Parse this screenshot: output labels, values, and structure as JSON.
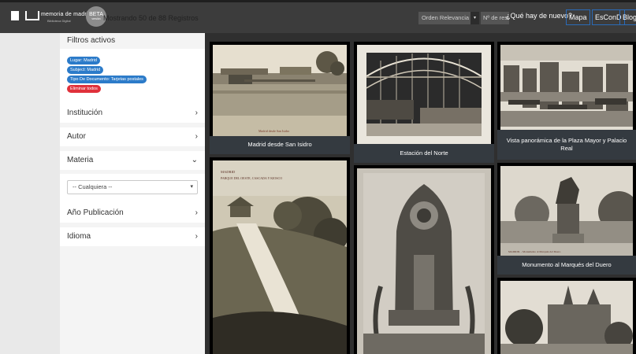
{
  "header": {
    "logo_title": "memoria de madrid",
    "logo_subtitle": "Biblioteca Digital",
    "beta_label": "BETA",
    "beta_sub": "versión",
    "results_text": "Mostrando 50 de 88 Registros",
    "sort_label": "Orden Relevancia",
    "per_page_label": "Nº de resultados",
    "nav": {
      "news": "¿Qué hay de nuevo?",
      "map": "Mapa",
      "escond": "EsConD",
      "blog": "Blog"
    }
  },
  "sidebar": {
    "filters_title": "Filtros activos",
    "chips": [
      {
        "label": "Lugar: Madrid",
        "color": "#2c7bc9"
      },
      {
        "label": "Subject: Madrid",
        "color": "#2c7bc9"
      },
      {
        "label": "Tipo De Documento: Tarjetas postales",
        "color": "#2c7bc9"
      },
      {
        "label": "Eliminar todos",
        "color": "#e0313b"
      }
    ],
    "facets": {
      "institucion": "Institución",
      "autor": "Autor",
      "materia": "Materia",
      "anio": "Año Publicación",
      "idioma": "Idioma"
    },
    "materia_select": "-- Cualquiera --"
  },
  "gallery": {
    "items": [
      {
        "title": "Madrid desde San Isidro"
      },
      {
        "title": "Estación del Norte"
      },
      {
        "title": "Vista panorámica de la Plaza Mayor y Palacio Real"
      },
      {
        "title": "Monumento al Marqués del Duero"
      }
    ],
    "postcard_caption_1": "Madrid desde San Isidro",
    "postcard_caption_2": "MADRID",
    "postcard_caption_3": "PARQUE DEL OESTE, CASCADA Y KIOSCO",
    "postcard_caption_4": "MADRID. - Monumento al Marqués del Duero"
  }
}
